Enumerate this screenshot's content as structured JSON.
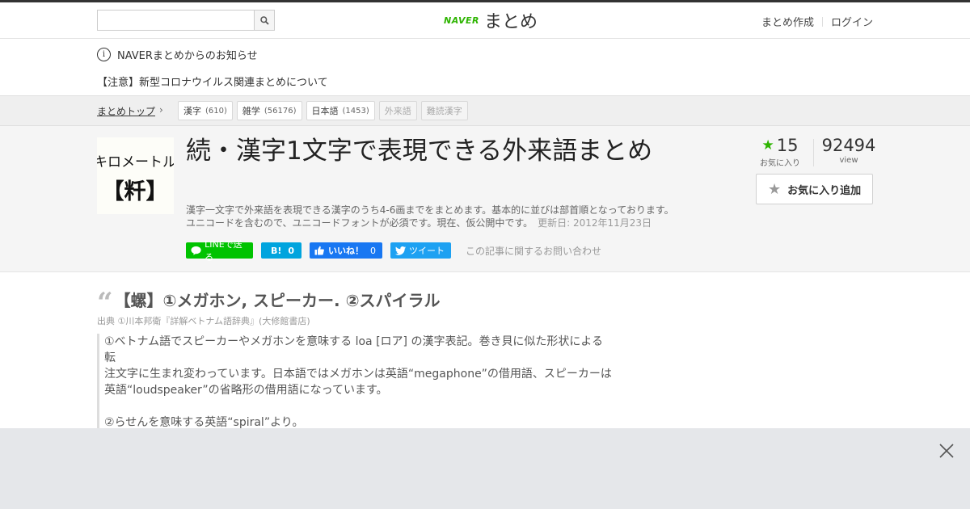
{
  "header": {
    "search_placeholder": "",
    "logo_naver": "NAVER",
    "logo_matome": "まとめ",
    "links": [
      "まとめ作成",
      "ログイン"
    ]
  },
  "notices": {
    "title": "NAVERまとめからのお知らせ",
    "item": "【注意】新型コロナウイルス関連まとめについて"
  },
  "breadcrumb": {
    "top": "まとめトップ",
    "tags": [
      {
        "label": "漢字",
        "count": "(610)"
      },
      {
        "label": "雑学",
        "count": "(56176)"
      },
      {
        "label": "日本語",
        "count": "(1453)"
      },
      {
        "label": "外来語",
        "count": ""
      },
      {
        "label": "難読漢字",
        "count": ""
      }
    ]
  },
  "article": {
    "thumb_text_top": "キロメートル",
    "thumb_text_bottom": "【粁】",
    "title": "続・漢字1文字で表現できる外来語まとめ",
    "description_1": "漢字一文字で外来語を表現できる漢字のうち4-6画までをまとめます。基本的に並びは部首順となっております。",
    "description_2": "ユニコードを含むので、ユニコードフォントが必須です。現在、仮公開中です。",
    "updated": "更新日: 2012年11月23日",
    "share": {
      "line": "LINEで送る",
      "hatena_icon": "B!",
      "hatena_count": "0",
      "fb_label": "いいね！",
      "fb_count": "0",
      "tweet": "ツイート",
      "contact": "この記事に関するお問い合わせ"
    },
    "stats": {
      "fav_count": "15",
      "fav_label": "お気に入り",
      "view_count": "92494",
      "view_label": "view"
    },
    "fav_button": "お気に入り追加"
  },
  "content": {
    "heading": "【螺】①メガホン, スピーカー. ②スパイラル",
    "source": "出典  ①川本邦衛『詳解ベトナム語辞典』(大修館書店)",
    "quote_lines": [
      "①ベトナム語でスピーカーやメガホンを意味する loa [ロア] の漢字表記。巻き貝に似た形状による転",
      "注文字に生まれ変わっています。日本語ではメガホンは英語“megaphone”の借用語、スピーカーは",
      "英語“loudspeaker”の省略形の借用語になっています。",
      "",
      "②らせんを意味する英語“spiral”より。"
    ]
  },
  "colors": {
    "brand_green": "#2db400",
    "line_green": "#00c300",
    "hatena_blue": "#00a4de",
    "facebook_blue": "#1877f2",
    "twitter_blue": "#1da1f2"
  },
  "icons": {
    "search": "search-icon",
    "info": "info-icon",
    "chevron": "chevron-right-icon",
    "star": "star-icon",
    "close": "close-icon",
    "quote": "quote-icon"
  }
}
